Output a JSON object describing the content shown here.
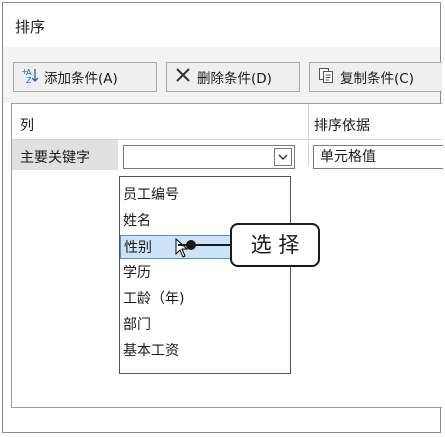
{
  "dialog": {
    "title": "排序"
  },
  "toolbar": {
    "add_label": "添加条件(A)",
    "delete_label": "删除条件(D)",
    "copy_label": "复制条件(C)"
  },
  "grid": {
    "column_header": "列",
    "sort_on_header": "排序依据",
    "row_label": "主要关键字",
    "column_value": "",
    "sort_on_value": "单元格值"
  },
  "dropdown": {
    "items": [
      "员工编号",
      "姓名",
      "性别",
      "学历",
      "工龄（年)",
      "部门",
      "基本工资"
    ],
    "highlighted_index": 2
  },
  "callout": {
    "text": "选 择"
  },
  "icons": {
    "add": "add-sort-icon",
    "delete": "delete-x-icon",
    "copy": "copy-icon",
    "dropdown_arrow": "chevron-down-icon",
    "cursor": "mouse-pointer-icon"
  },
  "colors": {
    "highlight": "#cde3f7",
    "highlight_border": "#4a90d9",
    "toolbar_bg": "#f3f3f3"
  }
}
